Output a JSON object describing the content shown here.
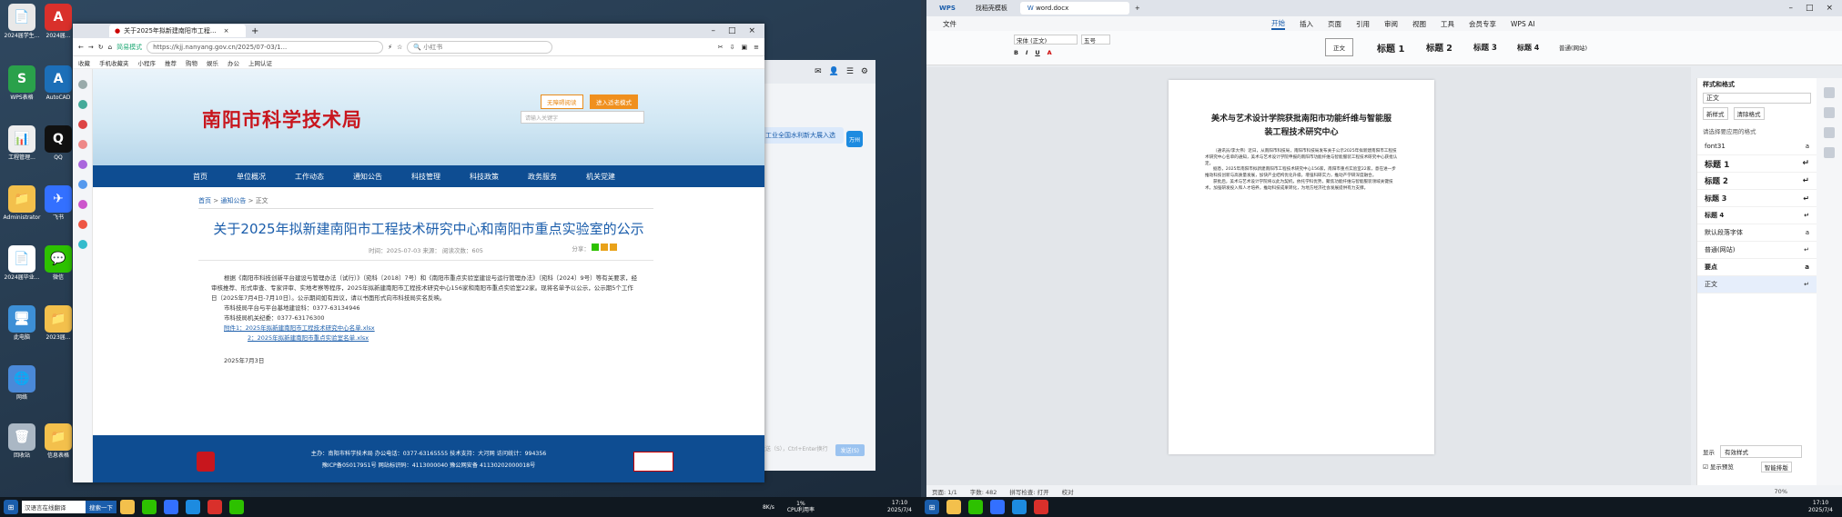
{
  "desktop": {
    "icons": [
      "2024届学生...",
      "2024届...",
      "WPS表格",
      "AutoCAD",
      "工程管理...",
      "QQ",
      "Administrator",
      "飞书",
      "2024届毕业...",
      "微信",
      "此电脑",
      "2023届...",
      "回收站",
      "网络",
      "回收站",
      "信息表格"
    ]
  },
  "browser": {
    "tab_title": "关于2025年拟新建南阳市工程...",
    "url": "https://kjj.nanyang.gov.cn/2025/07-03/1...",
    "search_placeholder": "小红书",
    "cert": "简易模式",
    "bookmarks": [
      "收藏",
      "手机收藏夹",
      "小程序",
      "推荐",
      "购物",
      "娱乐",
      "办公",
      "上网认证"
    ]
  },
  "site": {
    "logo": "南阳市科学技术局",
    "btn_barrier": "无障碍阅读",
    "btn_elder": "进入适老模式",
    "search_placeholder": "请输入关键字",
    "nav": [
      "首页",
      "单位概况",
      "工作动态",
      "通知公告",
      "科技管理",
      "科技政策",
      "政务服务",
      "机关党建"
    ],
    "crumb": {
      "home": "首页",
      "sep": ">",
      "section": "通知公告",
      "sub": "正文"
    },
    "title": "关于2025年拟新建南阳市工程技术研究中心和南阳市重点实验室的公示",
    "meta": "时间：2025-07-03    来源：    阅读次数：605",
    "share": "分享：",
    "para1": "根据《南阳市科技创新平台建设与管理办法（试行）》（宛科〔2018〕7号）和《南阳市重点实验室建设与运行管理办法》（宛科〔2024〕9号）等有关要求，经审核推荐、形式审查、专家评审、实地考察等程序，2025年拟新建南阳市工程技术研究中心156家和南阳市重点实验室22家。现将名单予以公示，公示期5个工作日（2025年7月4日-7月10日）。公示期间如有异议，请以书面形式向市科技局实名反映。",
    "contact1": "市科技局平台与平台基地建设科：0377-63134946",
    "contact2": "市科技局机关纪委：0377-63176300",
    "att1": "附件1：2025年拟新建南阳市工程技术研究中心名单.xlsx",
    "att2": "2：2025年拟新建南阳市重点实验室名单.xlsx",
    "date": "2025年7月3日",
    "footer1": "主办：南阳市科学技术局   办公电话：0377-63165555   技术支持：大河网   访问统计：994356",
    "footer2": "豫ICP备05017951号    网站标识码：4113000040    豫公网安备 41130202000018号"
  },
  "chat": {
    "bubble": "工业全国水利新大展入选",
    "hint": "发送（S），Ctrl+Enter换行",
    "send": "发送(S)",
    "tag": "万州"
  },
  "word": {
    "tabs": [
      "WPS",
      "找稻壳模板",
      "word.docx"
    ],
    "menu": [
      "文件",
      "开始",
      "插入",
      "页面",
      "引用",
      "审阅",
      "视图",
      "工具",
      "会员专享",
      "WPS AI"
    ],
    "font_name": "宋体 (正文)",
    "font_size": "五号",
    "styles": [
      "正文",
      "标题 1",
      "标题 2",
      "标题 3",
      "标题 4",
      "普通(网站)"
    ],
    "doc_title": "美术与艺术设计学院获批南阳市功能纤维与智能服装工程技术研究中心",
    "doc_p1": "（通讯员/李大伟）近日，从南阳市科技局，南阳市科技局发布关于公示2025年拟新建南阳市工程技术研究中心名单的通知，美术与艺术设计学院申报的南阳市功能纤维与智能服装工程技术研究中心获批认定。",
    "doc_p2": "据悉，2025年南阳市拟新建南阳市工程技术研究中心156家，南阳市重点实验室22家，意在进一步推动科技创新与高质量发展，加快产业结构优化升级，增强科研实力，推动产学研深度融合。",
    "doc_p3": "获批后，美术与艺术设计学院将以此为契机，依托学科优势，聚焦功能纤维与智能服装领域关键技术，加强研发投入和人才培养，推动科技成果转化，为地方经济社会发展提供有力支撑。",
    "pane_title": "样式和格式",
    "pane_current": "正文",
    "pane_new": "新样式",
    "pane_clear": "清除格式",
    "pane_label": "请选择要应用的格式",
    "pane_items": [
      "font31",
      "标题 1",
      "标题 2",
      "标题 3",
      "标题 4",
      "默认段落字体",
      "普通(网站)",
      "要点",
      "正文"
    ],
    "pane_show_label": "显示",
    "pane_show_value": "有效样式",
    "pane_preview": "显示预览",
    "pane_smart": "智能排版",
    "status": [
      "页面: 1/1",
      "字数: 482",
      "拼写检查: 打开",
      "校对"
    ],
    "zoom": "70%"
  },
  "taskbar": {
    "search": "汉语言在线翻译",
    "search_btn": "搜索一下",
    "net": "8K/s",
    "cpu": "1%",
    "cpu_label": "CPU利用率",
    "time": "17:10",
    "date": "2025/7/4"
  }
}
